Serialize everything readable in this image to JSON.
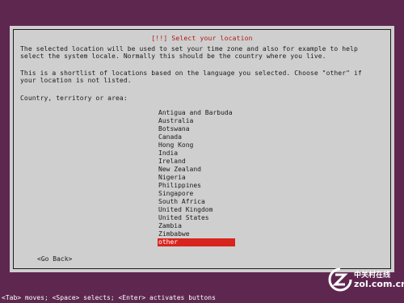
{
  "dialog": {
    "title": "[!!] Select your location",
    "paragraph1": "The selected location will be used to set your time zone and also for example to help\nselect the system locale. Normally this should be the country where you live.",
    "paragraph2": "This is a shortlist of locations based on the language you selected. Choose \"other\" if\nyour location is not listed.",
    "prompt": "Country, territory or area:",
    "countries": [
      "Antigua and Barbuda",
      "Australia",
      "Botswana",
      "Canada",
      "Hong Kong",
      "India",
      "Ireland",
      "New Zealand",
      "Nigeria",
      "Philippines",
      "Singapore",
      "South Africa",
      "United Kingdom",
      "United States",
      "Zambia",
      "Zimbabwe",
      "other"
    ],
    "selected_country": "other",
    "go_back_label": "<Go Back>"
  },
  "status_bar": {
    "text": "<Tab> moves; <Space> selects; <Enter> activates buttons"
  },
  "watermark": {
    "cn_text": "中关村在线",
    "url_text": "zol.com.cn",
    "logo_icon": "zol-logo-icon"
  },
  "colors": {
    "background": "#5e2750",
    "dialog": "#cfcfcf",
    "title": "#b01818",
    "selection": "#d8241e"
  }
}
